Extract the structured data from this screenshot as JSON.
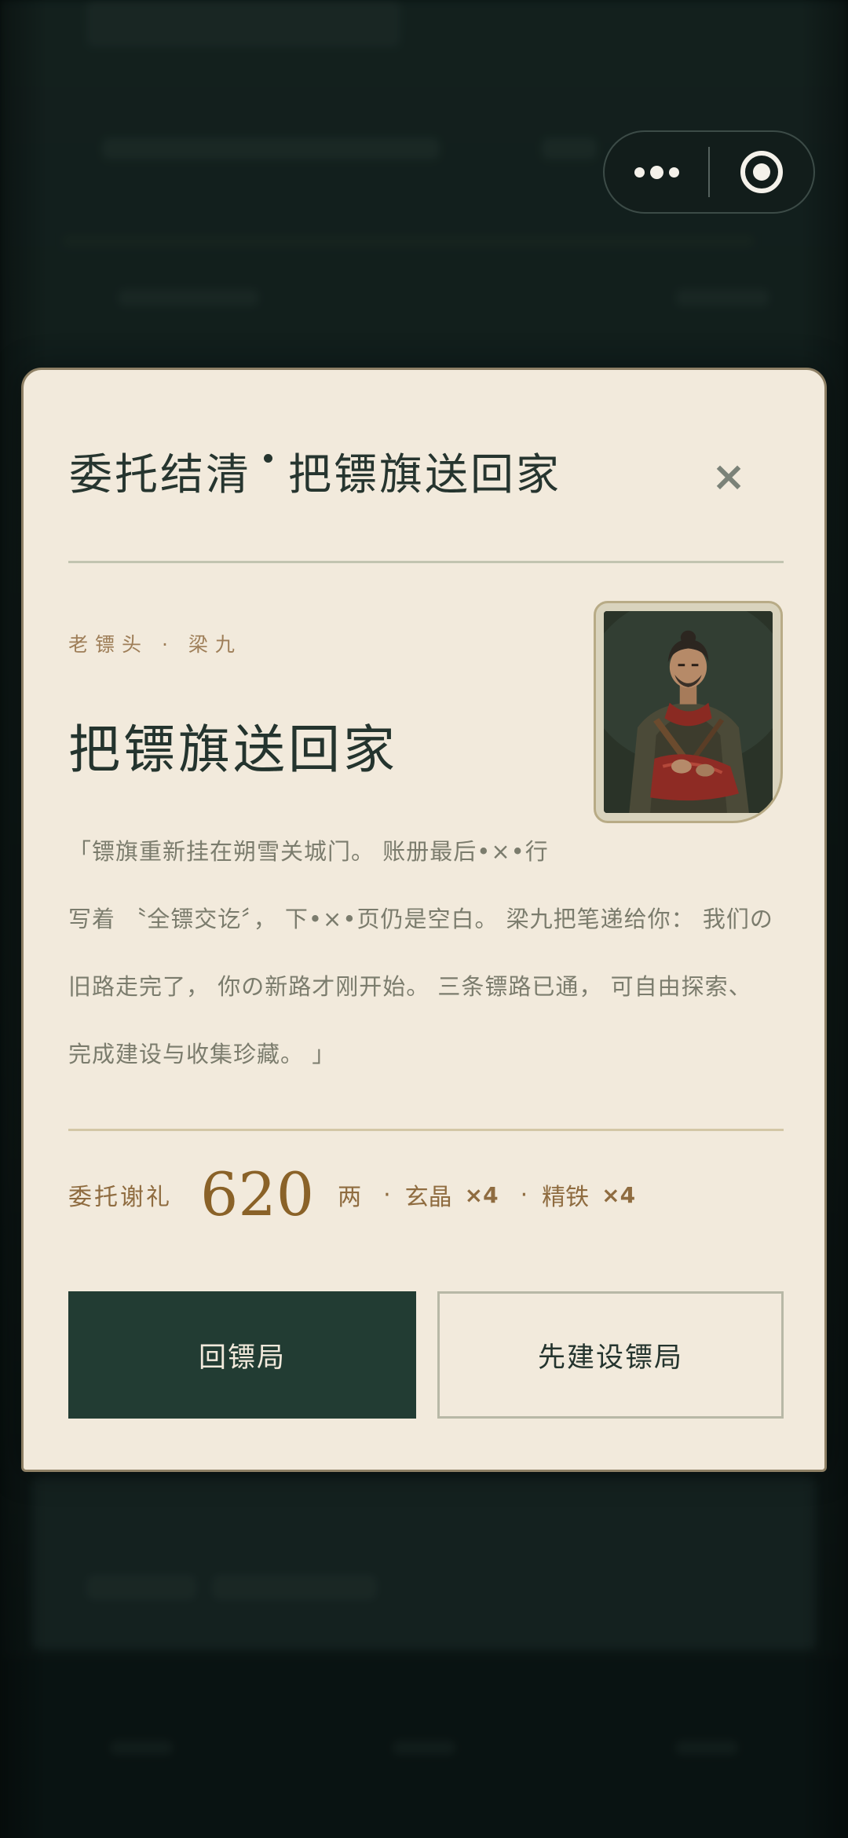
{
  "modal": {
    "title_part1": "委托结清",
    "title_part2": "把镖旗送回家",
    "close_label": "×",
    "speaker": "老镖头 · 梁九",
    "heading": "把镖旗送回家",
    "quote_lines": [
      "「镖旗重新挂在朔雪关城门。 账册最后•×•行",
      "写着 〝全镖交讫〞， 下•×•页仍是空白。 梁九把笔递给你：  我们の",
      "旧路走完了， 你の新路才刚开始。 三条镖路已通， 可自由探索、",
      "完成建设与收集珍藏。 」"
    ]
  },
  "reward": {
    "label": "委托谢礼",
    "amount": "620",
    "unit": "两",
    "separator": "·",
    "items": [
      {
        "name": "玄晶",
        "qty": "×4"
      },
      {
        "name": "精铁",
        "qty": "×4"
      }
    ]
  },
  "buttons": {
    "primary": "回镖局",
    "secondary": "先建设镖局"
  },
  "capsule": {
    "more_icon": "more-dots-icon",
    "close_icon": "target-circle-icon"
  },
  "colors": {
    "card_bg": "#f2eadc",
    "primary_green": "#223c33",
    "gold_text": "#8a6228",
    "overlay": "#0c1a17"
  }
}
